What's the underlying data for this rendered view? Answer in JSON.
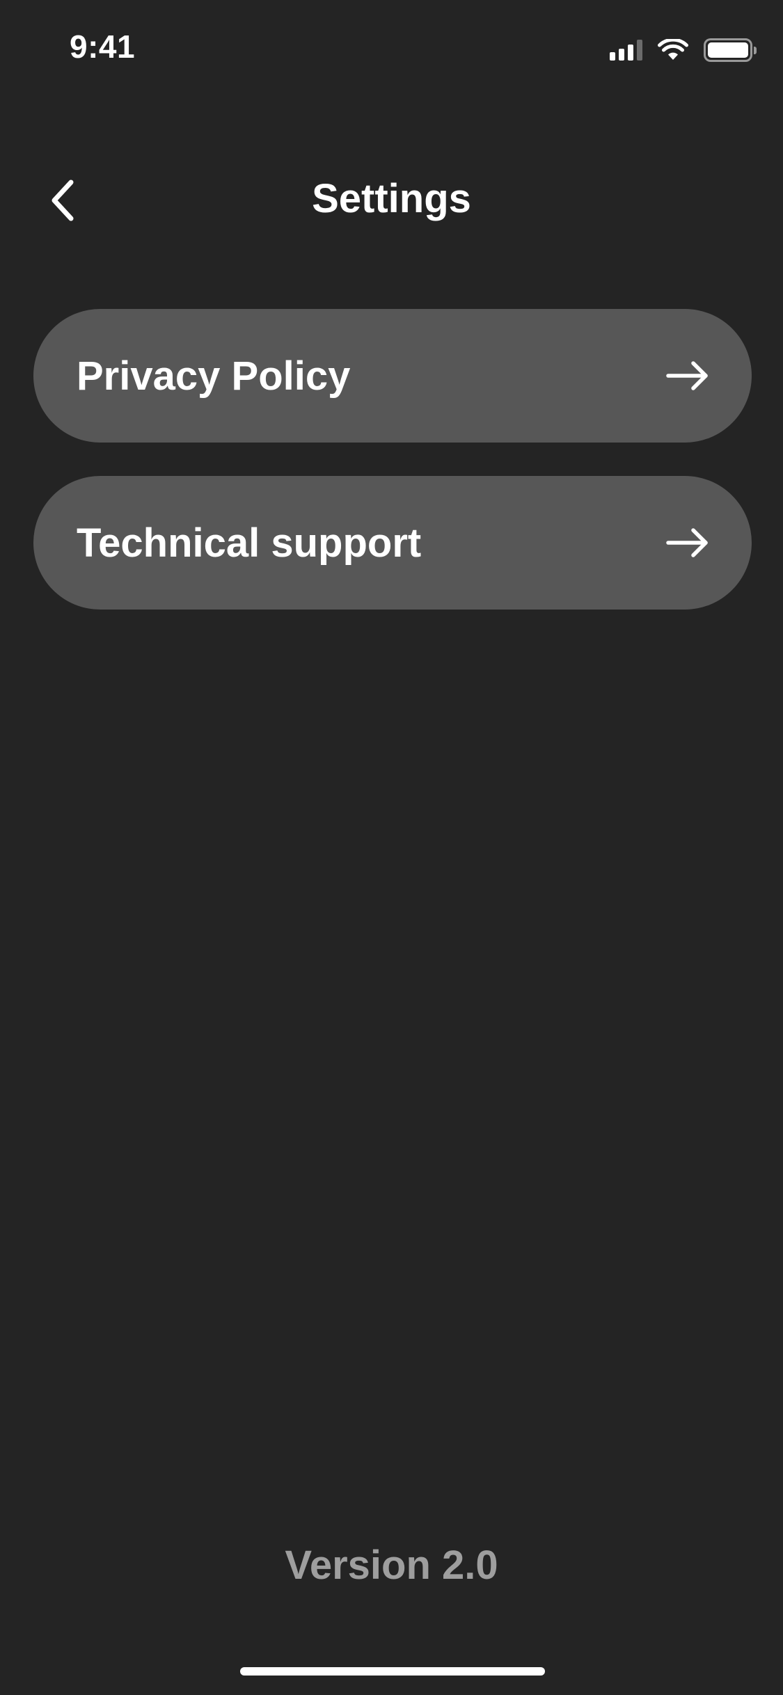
{
  "status_bar": {
    "time": "9:41",
    "icons": [
      "signal-icon",
      "wifi-icon",
      "battery-icon"
    ]
  },
  "header": {
    "back_icon": "chevron-left-icon",
    "title": "Settings"
  },
  "menu": {
    "items": [
      {
        "label": "Privacy Policy",
        "icon": "arrow-right-icon"
      },
      {
        "label": "Technical support",
        "icon": "arrow-right-icon"
      }
    ]
  },
  "footer": {
    "version": "Version 2.0"
  },
  "colors": {
    "background": "#242424",
    "menu_item_bg": "#575757",
    "text_primary": "#ffffff",
    "text_secondary": "#9e9e9e"
  }
}
